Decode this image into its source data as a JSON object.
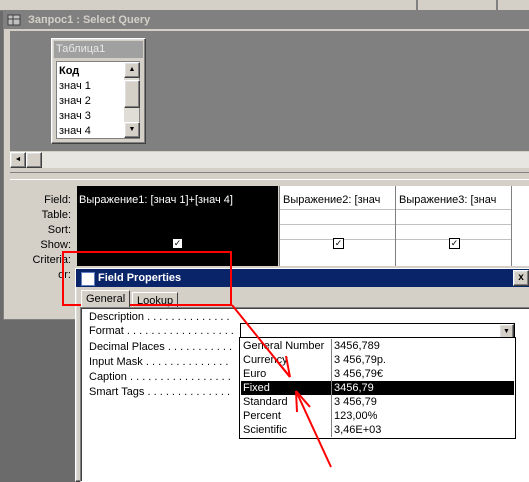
{
  "query_window": {
    "title": "Запрос1 : Select Query",
    "table": {
      "name": "Таблица1",
      "fields": [
        "Код",
        "знач 1",
        "знач 2",
        "знач 3",
        "знач 4"
      ]
    },
    "row_labels": [
      "Field:",
      "Table:",
      "Sort:",
      "Show:",
      "Criteria:",
      "or:"
    ],
    "columns": [
      {
        "field": "Выражение1: [знач 1]+[знач 4]",
        "show": true
      },
      {
        "field": "Выражение2: [знач",
        "show": true
      },
      {
        "field": "Выражение3: [знач",
        "show": true
      }
    ]
  },
  "field_properties": {
    "title": "Field Properties",
    "close_glyph": "x",
    "tabs": [
      "General",
      "Lookup"
    ],
    "properties": [
      "Description . . . . . . . . . . . . . .",
      "Format . . . . . . . . . . . . . . . . . .",
      "Decimal Places . . . . . . . . . . .",
      "Input Mask . . . . . . . . . . . . . .",
      "Caption . . . . . . . . . . . . . . . . .",
      "Smart Tags . . . . . . . . . . . . . ."
    ],
    "format_value": "",
    "format_options": [
      {
        "name": "General Number",
        "example": "3456,789"
      },
      {
        "name": "Currency",
        "example": "3 456,79р."
      },
      {
        "name": "Euro",
        "example": "3 456,79€"
      },
      {
        "name": "Fixed",
        "example": "3456,79",
        "selected": true
      },
      {
        "name": "Standard",
        "example": "3 456,79"
      },
      {
        "name": "Percent",
        "example": "123,00%"
      },
      {
        "name": "Scientific",
        "example": "3,46E+03"
      }
    ]
  },
  "annotation_color": "#ff0000"
}
